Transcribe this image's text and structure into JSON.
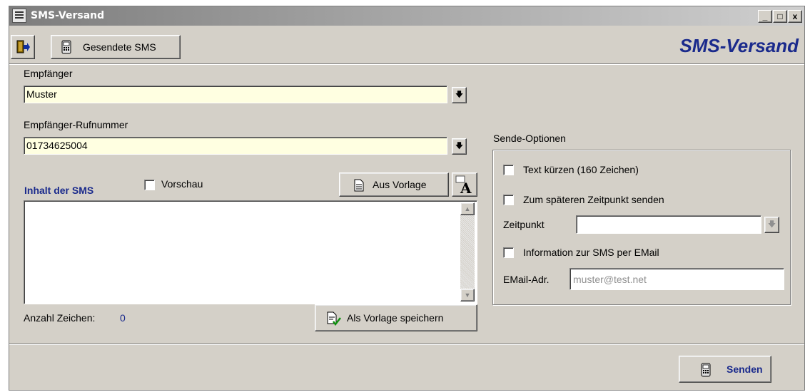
{
  "window": {
    "title": "SMS-Versand",
    "controls": {
      "minimize": "_",
      "maximize": "□",
      "close": "x"
    }
  },
  "toolbar": {
    "sent_sms_label": "Gesendete SMS",
    "brand_title": "SMS-Versand",
    "brand_color": "#1a2a8c"
  },
  "recipient": {
    "label": "Empfänger",
    "value": "Muster"
  },
  "phone": {
    "label": "Empfänger-Rufnummer",
    "value": "01734625004"
  },
  "message": {
    "label": "Inhalt der SMS",
    "preview_label": "Vorschau",
    "from_template_label": "Aus Vorlage",
    "text": "",
    "char_count_label": "Anzahl Zeichen:",
    "char_count": "0",
    "save_template_label": "Als Vorlage speichern"
  },
  "send_options": {
    "title": "Sende-Optionen",
    "shorten_label": "Text kürzen (160 Zeichen)",
    "later_label": "Zum späteren Zeitpunkt senden",
    "time_label": "Zeitpunkt",
    "time_value": "",
    "email_info_label": "Information zur SMS per EMail",
    "email_label": "EMail-Adr.",
    "email_placeholder": "muster@test.net"
  },
  "footer": {
    "send_label": "Senden"
  }
}
